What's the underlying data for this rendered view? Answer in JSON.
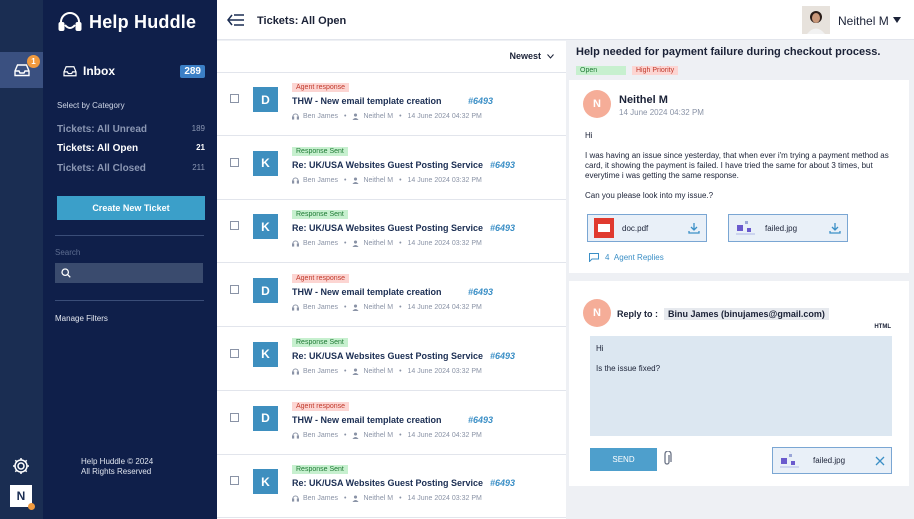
{
  "rail": {
    "inbox_badge": "1",
    "avatar_initial": "N",
    "icons": [
      "inbox-icon",
      "gear-icon"
    ]
  },
  "sidebar": {
    "brand": "Help Huddle",
    "inbox_label": "Inbox",
    "inbox_count": "289",
    "category_title": "Select by Category",
    "categories": [
      {
        "label": "Tickets: All Unread",
        "count": "189"
      },
      {
        "label": "Tickets: All Open",
        "count": "21"
      },
      {
        "label": "Tickets: All Closed",
        "count": "211"
      }
    ],
    "active_category": 1,
    "create_button": "Create New Ticket",
    "search_label": "Search",
    "search_value": "",
    "manage_filters": "Manage Filters",
    "copyright_line1": "Help Huddle © 2024",
    "copyright_line2": "All Rights Reserved"
  },
  "header": {
    "title": "Tickets: All Open",
    "user_name": "Neithel M"
  },
  "list": {
    "sort_label": "Newest",
    "tickets": [
      {
        "initial": "D",
        "tag": "Agent response",
        "tag_type": "agent",
        "subject": "THW - New email template creation",
        "id": "#6493",
        "assignee": "Ben James",
        "requester": "Neithel M",
        "date": "14 June 2024 04:32 PM"
      },
      {
        "initial": "K",
        "tag": "Response  Sent",
        "tag_type": "sent",
        "subject": "Re: UK/USA Websites Guest Posting Service",
        "id": "#6493",
        "assignee": "Ben James",
        "requester": "Neithel M",
        "date": "14 June 2024 03:32 PM"
      },
      {
        "initial": "K",
        "tag": "Response  Sent",
        "tag_type": "sent",
        "subject": "Re: UK/USA Websites Guest Posting Service",
        "id": "#6493",
        "assignee": "Ben James",
        "requester": "Neithel M",
        "date": "14 June 2024 03:32 PM"
      },
      {
        "initial": "D",
        "tag": "Agent response",
        "tag_type": "agent",
        "subject": "THW - New email template creation",
        "id": "#6493",
        "assignee": "Ben James",
        "requester": "Neithel M",
        "date": "14 June 2024 04:32 PM"
      },
      {
        "initial": "K",
        "tag": "Response  Sent",
        "tag_type": "sent",
        "subject": "Re: UK/USA Websites Guest Posting Service",
        "id": "#6493",
        "assignee": "Ben James",
        "requester": "Neithel M",
        "date": "14 June 2024 03:32 PM"
      },
      {
        "initial": "D",
        "tag": "Agent response",
        "tag_type": "agent",
        "subject": "THW - New email template creation",
        "id": "#6493",
        "assignee": "Ben James",
        "requester": "Neithel M",
        "date": "14 June 2024 04:32 PM"
      },
      {
        "initial": "K",
        "tag": "Response  Sent",
        "tag_type": "sent",
        "subject": "Re: UK/USA Websites Guest Posting Service",
        "id": "#6493",
        "assignee": "Ben James",
        "requester": "Neithel M",
        "date": "14 June 2024 03:32 PM"
      }
    ]
  },
  "detail": {
    "title": "Help needed for payment failure during checkout process.",
    "status": "Open",
    "priority": "High Priority",
    "message": {
      "initial": "N",
      "author": "Neithel M",
      "date": "14 June 2024 04:32 PM",
      "greeting": "Hi",
      "body": "I was having an issue since yesterday, that when ever i'm trying a payment method as card, it showing the payment is failed. I have tried the same for about 3 times, but everytime i was getting the same response.",
      "closing": "Can you please look into my issue.?"
    },
    "attachments": [
      {
        "name": "doc.pdf",
        "icon": "pdf-file-icon"
      },
      {
        "name": "failed.jpg",
        "icon": "image-file-icon"
      }
    ],
    "replies_count": "4",
    "replies_label": "Agent Replies"
  },
  "reply": {
    "initial": "N",
    "to_label": "Reply to :",
    "to_value": "Binu James (binujames@gmail.com)",
    "format_label": "HTML",
    "line1": "Hi",
    "line2": "Is the issue fixed?",
    "send_label": "SEND",
    "attachment": "failed.jpg"
  },
  "colors": {
    "sidebar_bg": "#0f1f4a",
    "rail_bg": "#1a2d52",
    "accent": "#3b9fc9",
    "agent_tag": "#fcd5d2",
    "sent_tag": "#c7f0cf"
  }
}
